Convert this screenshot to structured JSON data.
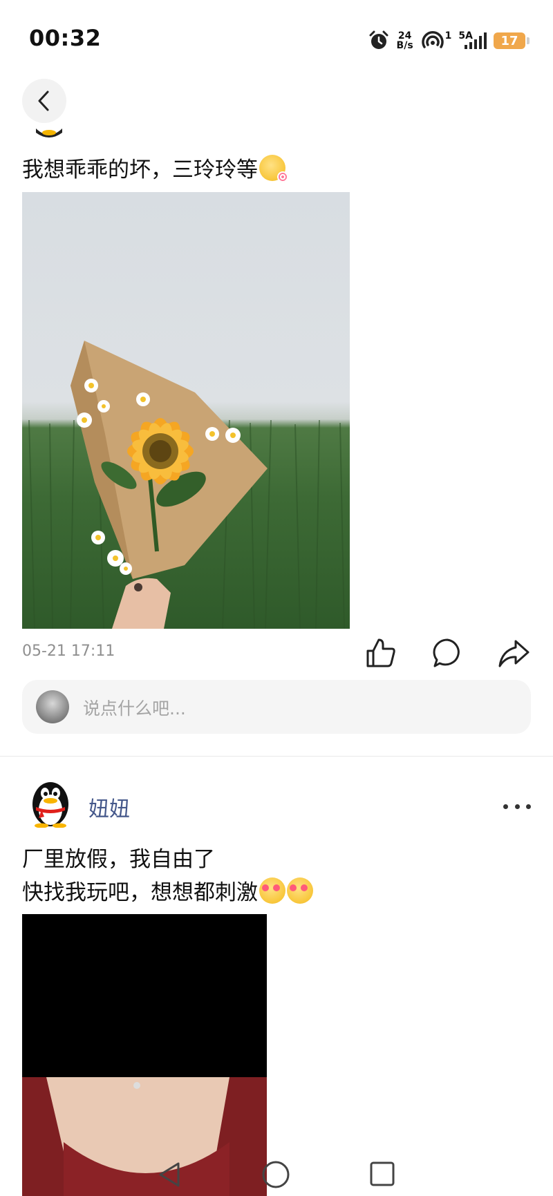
{
  "status_bar": {
    "time": "00:32",
    "net_speed_value": "24",
    "net_speed_unit": "B/s",
    "wifi_badge": "1",
    "network_type": "5A",
    "battery": "17",
    "icons": [
      "alarm-icon",
      "hotspot-icon",
      "signal-icon",
      "battery-icon"
    ]
  },
  "post1": {
    "text": "我想乖乖的坏，三玲玲等",
    "emoji": "lollipop-face-emoji",
    "image": "sunflower-bouquet-photo",
    "date": "05-21 17:11"
  },
  "comment": {
    "placeholder": "说点什么吧..."
  },
  "post2": {
    "username": "妞妞",
    "line1": "厂里放假，我自由了",
    "line2": "快找我玩吧，想想都刺激",
    "emoji": "heart-eyes-emoji"
  },
  "colors": {
    "username": "#44578a",
    "battery": "#f0a74b",
    "date": "#8f8f8f"
  }
}
